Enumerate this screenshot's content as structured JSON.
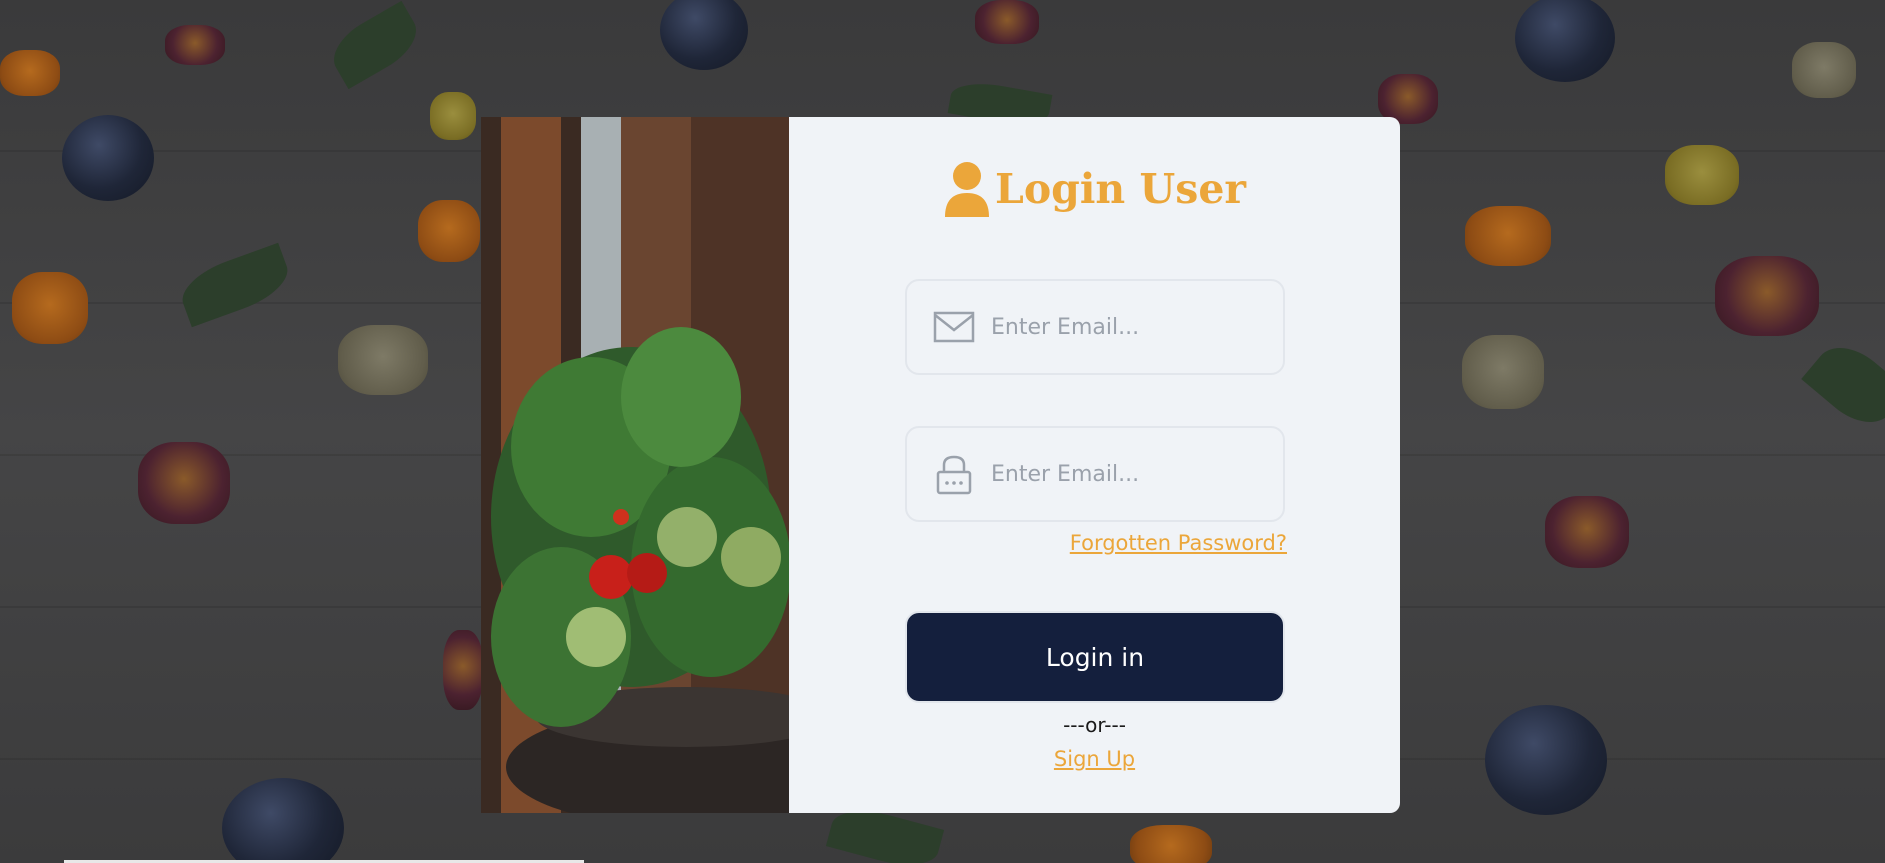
{
  "form": {
    "title": "Login User",
    "email_placeholder": "Enter Email...",
    "password_placeholder": "Enter Email...",
    "forgot_password": "Forgotten Password?",
    "login_button": "Login in",
    "or_separator": "---or---",
    "signup_link": "Sign Up"
  },
  "icons": {
    "title_icon": "user-icon",
    "email_icon": "envelope-icon",
    "password_icon": "lock-icon"
  },
  "colors": {
    "accent": "#eba63a",
    "button_bg": "#141f3d",
    "form_bg": "#f0f3f7",
    "input_border": "#e2e6ec",
    "placeholder": "#9aa1ab"
  }
}
